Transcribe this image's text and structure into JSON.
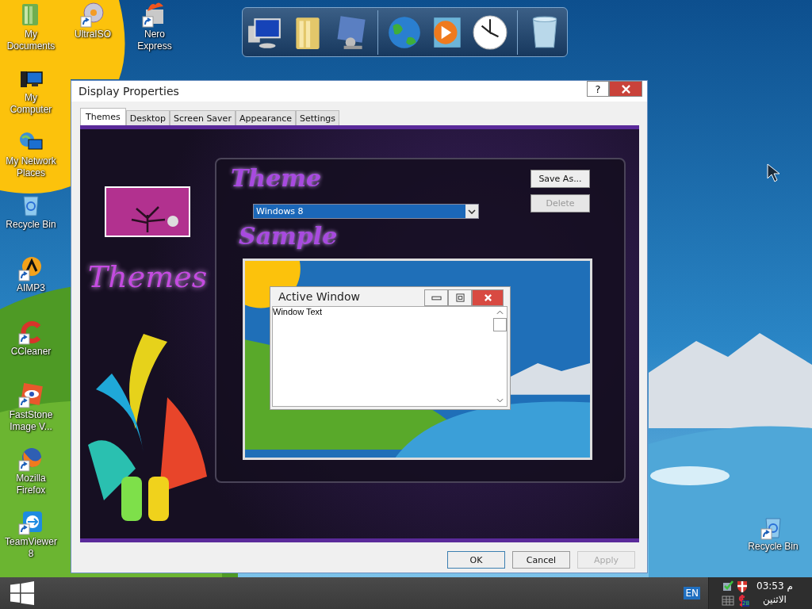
{
  "dock": {
    "groups": [
      [
        {
          "kind": "monitor"
        },
        {
          "kind": "folder"
        },
        {
          "kind": "control-panel"
        }
      ],
      [
        {
          "kind": "globe"
        },
        {
          "kind": "media"
        },
        {
          "kind": "clock"
        }
      ],
      [
        {
          "kind": "trash"
        }
      ]
    ]
  },
  "desktop": {
    "icon_columns": [
      [
        {
          "label": "My Documents",
          "kind": "documents",
          "shortcut": false
        },
        {
          "label": "My Computer",
          "kind": "computer",
          "shortcut": false
        },
        {
          "label": "My Network Places",
          "kind": "network",
          "shortcut": false
        },
        {
          "label": "Recycle Bin",
          "kind": "recycle",
          "shortcut": false
        },
        {
          "label": "AIMP3",
          "kind": "aimp",
          "shortcut": true
        },
        {
          "label": "CCleaner",
          "kind": "ccleaner",
          "shortcut": true
        },
        {
          "label": "FastStone Image V...",
          "kind": "faststone",
          "shortcut": true
        },
        {
          "label": "Mozilla Firefox",
          "kind": "firefox",
          "shortcut": true
        },
        {
          "label": "TeamViewer 8",
          "kind": "teamviewer",
          "shortcut": true
        }
      ],
      [
        {
          "label": "UltraISO",
          "kind": "disc",
          "shortcut": true
        }
      ],
      [
        {
          "label": "Nero Express",
          "kind": "flame",
          "shortcut": true
        }
      ]
    ],
    "corner_icon": {
      "label": "Recycle Bin",
      "kind": "recycle",
      "shortcut": true
    }
  },
  "dialog": {
    "title": "Display Properties",
    "help_glyph": "?",
    "tabs": [
      {
        "label": "Themes",
        "selected": true
      },
      {
        "label": "Desktop",
        "selected": false
      },
      {
        "label": "Screen Saver",
        "selected": false
      },
      {
        "label": "Appearance",
        "selected": false
      },
      {
        "label": "Settings",
        "selected": false
      }
    ],
    "art_title": "Themes",
    "theme_label": "Theme",
    "theme_select": {
      "value": "Windows 8"
    },
    "side_buttons": [
      {
        "label": "Save As...",
        "disabled": false
      },
      {
        "label": "Delete",
        "disabled": true
      }
    ],
    "sample_label": "Sample",
    "preview": {
      "window_title": "Active Window",
      "window_text": "Window Text"
    },
    "buttons": [
      {
        "label": "OK",
        "disabled": false,
        "default": true
      },
      {
        "label": "Cancel",
        "disabled": false,
        "default": false
      },
      {
        "label": "Apply",
        "disabled": true,
        "default": false
      }
    ]
  },
  "taskbar": {
    "language": "EN",
    "tray": [
      {
        "kind": "check"
      },
      {
        "kind": "shield"
      },
      {
        "kind": "keyboard"
      },
      {
        "kind": "dollar",
        "badge": "28"
      }
    ],
    "time": "03:53 م",
    "day": "الاثنين"
  }
}
